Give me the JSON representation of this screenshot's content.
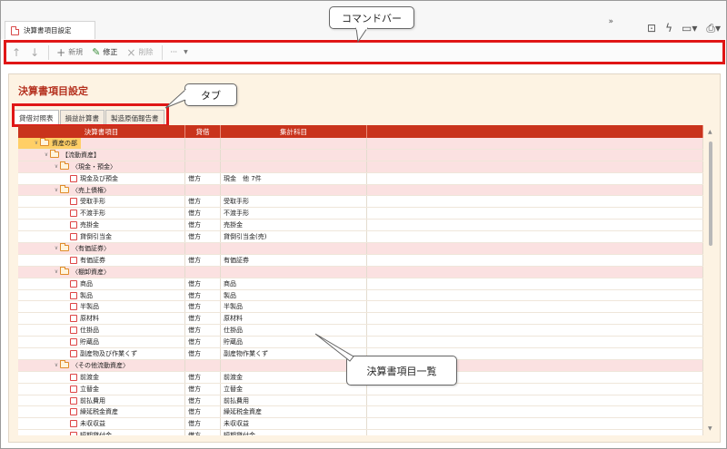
{
  "window": {
    "doc_tab_title": "決算書項目設定",
    "tools": [
      "»",
      "⊡",
      "ϟ",
      "▭▾",
      "⎙▾"
    ]
  },
  "command_bar": {
    "up_icon": "arrow-up-icon",
    "down_icon": "arrow-down-icon",
    "new_label": "新規",
    "edit_label": "修正",
    "delete_label": "削除",
    "more_label": "···"
  },
  "page": {
    "title": "決算書項目設定",
    "tabs": [
      "貸借対照表",
      "損益計算書",
      "製造原価報告書"
    ],
    "active_tab": 0
  },
  "grid": {
    "columns": [
      "決算書項目",
      "貸借",
      "集計科目",
      ""
    ],
    "rows": [
      {
        "label": "資産の部",
        "level": 0,
        "kind": "folder",
        "side": "",
        "summary": "",
        "selected": true
      },
      {
        "label": "【流動資産】",
        "level": 1,
        "kind": "folder",
        "side": "",
        "summary": ""
      },
      {
        "label": "〈現金・預金〉",
        "level": 2,
        "kind": "folder",
        "side": "",
        "summary": ""
      },
      {
        "label": "現金及び預金",
        "level": 3,
        "kind": "leaf",
        "side": "借方",
        "summary": "現金　他 7件"
      },
      {
        "label": "〈売上債権〉",
        "level": 2,
        "kind": "folder",
        "side": "",
        "summary": ""
      },
      {
        "label": "受取手形",
        "level": 3,
        "kind": "leaf",
        "side": "借方",
        "summary": "受取手形"
      },
      {
        "label": "不渡手形",
        "level": 3,
        "kind": "leaf",
        "side": "借方",
        "summary": "不渡手形"
      },
      {
        "label": "売掛金",
        "level": 3,
        "kind": "leaf",
        "side": "借方",
        "summary": "売掛金"
      },
      {
        "label": "貸倒引当金",
        "level": 3,
        "kind": "leaf",
        "side": "借方",
        "summary": "貸倒引当金(売)"
      },
      {
        "label": "〈有価証券〉",
        "level": 2,
        "kind": "folder",
        "side": "",
        "summary": ""
      },
      {
        "label": "有価証券",
        "level": 3,
        "kind": "leaf",
        "side": "借方",
        "summary": "有価証券"
      },
      {
        "label": "〈棚卸資産〉",
        "level": 2,
        "kind": "folder",
        "side": "",
        "summary": ""
      },
      {
        "label": "商品",
        "level": 3,
        "kind": "leaf",
        "side": "借方",
        "summary": "商品"
      },
      {
        "label": "製品",
        "level": 3,
        "kind": "leaf",
        "side": "借方",
        "summary": "製品"
      },
      {
        "label": "半製品",
        "level": 3,
        "kind": "leaf",
        "side": "借方",
        "summary": "半製品"
      },
      {
        "label": "原材料",
        "level": 3,
        "kind": "leaf",
        "side": "借方",
        "summary": "原材料"
      },
      {
        "label": "仕掛品",
        "level": 3,
        "kind": "leaf",
        "side": "借方",
        "summary": "仕掛品"
      },
      {
        "label": "貯蔵品",
        "level": 3,
        "kind": "leaf",
        "side": "借方",
        "summary": "貯蔵品"
      },
      {
        "label": "副産物及び作業くず",
        "level": 3,
        "kind": "leaf",
        "side": "借方",
        "summary": "副産物作業くず"
      },
      {
        "label": "〈その他流動資産〉",
        "level": 2,
        "kind": "folder",
        "side": "",
        "summary": ""
      },
      {
        "label": "前渡金",
        "level": 3,
        "kind": "leaf",
        "side": "借方",
        "summary": "前渡金"
      },
      {
        "label": "立替金",
        "level": 3,
        "kind": "leaf",
        "side": "借方",
        "summary": "立替金"
      },
      {
        "label": "前払費用",
        "level": 3,
        "kind": "leaf",
        "side": "借方",
        "summary": "前払費用"
      },
      {
        "label": "繰延税金資産",
        "level": 3,
        "kind": "leaf",
        "side": "借方",
        "summary": "繰延税金資産"
      },
      {
        "label": "未収収益",
        "level": 3,
        "kind": "leaf",
        "side": "借方",
        "summary": "未収収益"
      },
      {
        "label": "短期貸付金",
        "level": 3,
        "kind": "leaf",
        "side": "借方",
        "summary": "短期貸付金"
      }
    ]
  },
  "callouts": {
    "command_bar": "コマンドバー",
    "tabs": "タブ",
    "list": "決算書項目一覧"
  },
  "colors": {
    "accent_red": "#c9331c",
    "highlight_border": "#e01616",
    "group_row": "#fbe1e1",
    "selected": "#ffcf66",
    "panel_bg": "#fdf3e3"
  }
}
